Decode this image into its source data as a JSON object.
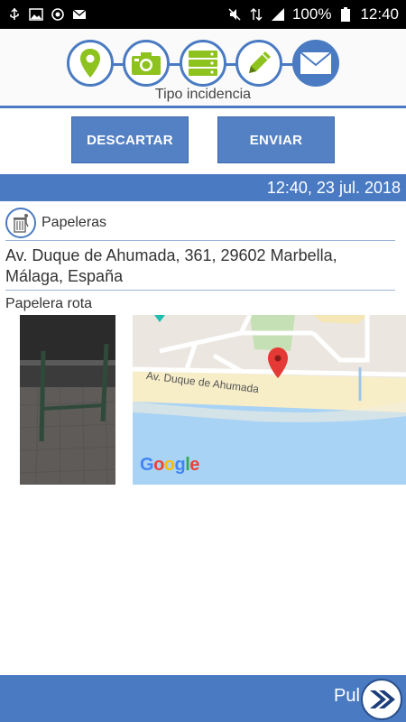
{
  "status_bar": {
    "battery_text": "100%",
    "time": "12:40",
    "left_icons": [
      "usb-icon",
      "image-icon",
      "sync-icon",
      "mail-icon"
    ],
    "right_icons": [
      "mute-icon",
      "data-icon",
      "signal-icon",
      "battery-icon"
    ]
  },
  "steps": {
    "title": "Tipo incidencia",
    "items": [
      {
        "name": "location",
        "icon": "map-pin-icon",
        "active": false
      },
      {
        "name": "photo",
        "icon": "camera-icon",
        "active": false
      },
      {
        "name": "list",
        "icon": "list-icon",
        "active": false
      },
      {
        "name": "edit",
        "icon": "pencil-icon",
        "active": false
      },
      {
        "name": "send",
        "icon": "envelope-icon",
        "active": true
      }
    ]
  },
  "actions": {
    "discard_label": "DESCARTAR",
    "send_label": "ENVIAR"
  },
  "report": {
    "datetime": "12:40, 23 jul. 2018",
    "category": "Papeleras",
    "address": "Av. Duque de Ahumada, 361, 29602 Marbella, Málaga, España",
    "description": "Papelera rota"
  },
  "map": {
    "street_label": "Av. Duque de Ahumada",
    "provider": "Google"
  },
  "footer": {
    "partial_text": "Pul",
    "next_icon": "double-chevron-right-icon"
  },
  "colors": {
    "accent": "#4a7bc2",
    "icon_green": "#8dc21f",
    "button": "#5480c4"
  }
}
